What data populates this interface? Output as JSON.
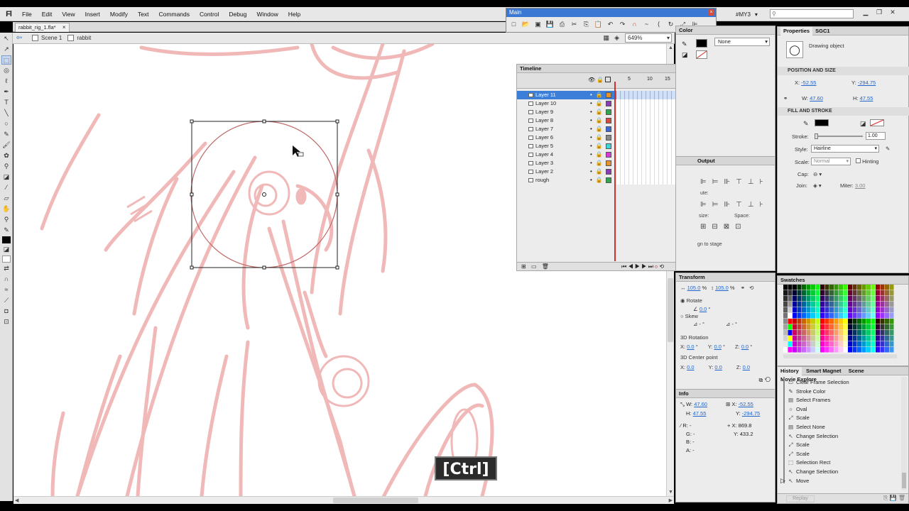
{
  "app": {
    "logo": "Fl"
  },
  "menu": [
    "File",
    "Edit",
    "View",
    "Insert",
    "Modify",
    "Text",
    "Commands",
    "Control",
    "Debug",
    "Window",
    "Help"
  ],
  "workspace": {
    "name": "#MY3",
    "search_placeholder": ""
  },
  "document": {
    "tab": "rabbit_rig_1.fla*",
    "scene": "Scene 1",
    "symbol": "rabbit",
    "zoom": "649%"
  },
  "main_toolbar": {
    "title": "Main"
  },
  "timeline": {
    "title": "Timeline",
    "frame_numbers": [
      "5",
      "10",
      "15",
      "20"
    ],
    "layers": [
      {
        "name": "Layer 11",
        "color": "#e8932a",
        "selected": true
      },
      {
        "name": "Layer 10",
        "color": "#8a3ab8"
      },
      {
        "name": "Layer 9",
        "color": "#2ea84a"
      },
      {
        "name": "Layer 8",
        "color": "#d84a3a"
      },
      {
        "name": "Layer 7",
        "color": "#3a6ad8"
      },
      {
        "name": "Layer 6",
        "color": "#888888"
      },
      {
        "name": "Layer 5",
        "color": "#3ad8d8"
      },
      {
        "name": "Layer 4",
        "color": "#d83ad8"
      },
      {
        "name": "Layer 3",
        "color": "#e8932a"
      },
      {
        "name": "Layer 2",
        "color": "#8a3ab8"
      },
      {
        "name": "rough",
        "color": "#2ea84a"
      }
    ]
  },
  "color_panel": {
    "tab": "Color",
    "type": "None"
  },
  "align_panel": {
    "tab": "Output",
    "match_size": "size:",
    "space": "Space:",
    "align_to_stage": "gn to stage",
    "label_top": "ute:"
  },
  "transform": {
    "tab": "Transform",
    "width_pct": "105.0",
    "height_pct": "105.0",
    "rotate": "Rotate",
    "rotate_val": "0.0",
    "skew": "Skew",
    "skew_a": "-",
    "skew_b": "-",
    "rot3d": "3D Rotation",
    "rx": "0.0",
    "ry": "0.0",
    "rz": "0.0",
    "center3d": "3D Center point",
    "cx": "0.0",
    "cy": "0.0",
    "cz": "0.0"
  },
  "info": {
    "tab": "Info",
    "w": "47.60",
    "h": "47.55",
    "x": "-52.55",
    "y": "-294.75",
    "r": "-",
    "g": "-",
    "b": "-",
    "a": "-",
    "mx": "869.8",
    "my": "433.2"
  },
  "properties": {
    "tabs": [
      "Properties",
      "SGC1"
    ],
    "object": "Drawing object",
    "pos_size": "POSITION AND SIZE",
    "x": "-52.55",
    "y": "-294.75",
    "w": "47.60",
    "h": "47.55",
    "fill_stroke": "FILL AND STROKE",
    "stroke_label": "Stroke:",
    "stroke_val": "1.00",
    "style_label": "Style:",
    "style_val": "Hairline",
    "scale_label": "Scale:",
    "scale_val": "Normal",
    "hinting": "Hinting",
    "cap_label": "Cap:",
    "join_label": "Join:",
    "miter_label": "Miter:",
    "miter_val": "3.00"
  },
  "swatches": {
    "tab": "Swatches"
  },
  "history": {
    "tabs": [
      "History",
      "Smart Magnet",
      "Scene",
      "Movie Explore"
    ],
    "items": [
      {
        "label": "Clear Frame Selection",
        "icon": "▭"
      },
      {
        "label": "Stroke Color",
        "icon": "✎"
      },
      {
        "label": "Select Frames",
        "icon": "▤"
      },
      {
        "label": "Oval",
        "icon": "○"
      },
      {
        "label": "Scale",
        "icon": "⤢"
      },
      {
        "label": "Select None",
        "icon": "▤"
      },
      {
        "label": "Change Selection",
        "icon": "↖"
      },
      {
        "label": "Scale",
        "icon": "⤢"
      },
      {
        "label": "Scale",
        "icon": "⤢"
      },
      {
        "label": "Selection Rect",
        "icon": "⬚"
      },
      {
        "label": "Change Selection",
        "icon": "↖"
      },
      {
        "label": "Move",
        "icon": "↖"
      }
    ],
    "replay": "Replay"
  },
  "overlay": {
    "key": "[Ctrl]"
  }
}
